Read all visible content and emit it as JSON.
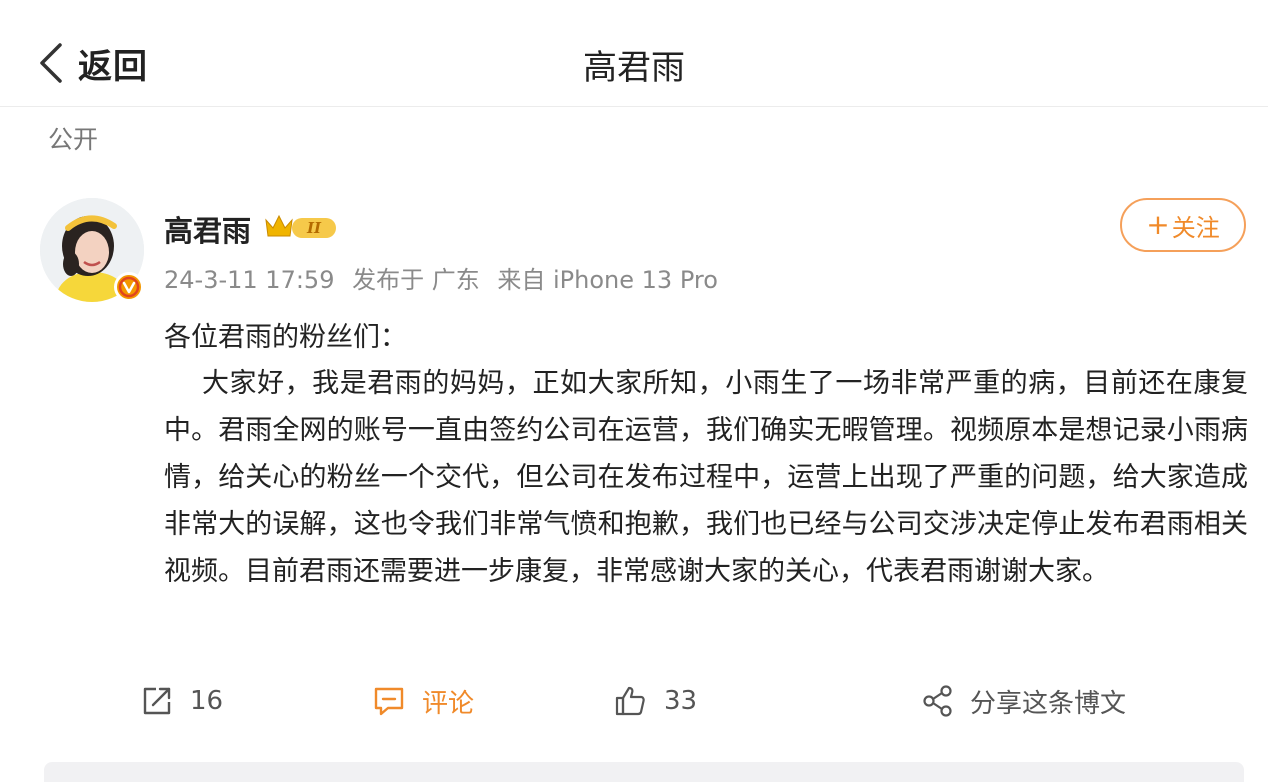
{
  "header": {
    "back_label": "返回",
    "title": "高君雨"
  },
  "post": {
    "visibility": "公开",
    "author": {
      "name": "高君雨",
      "vip_level": "II"
    },
    "meta": {
      "time": "24-3-11 17:59",
      "location": "发布于 广东",
      "source": "来自 iPhone 13 Pro"
    },
    "follow_label": "关注",
    "greeting": "各位君雨的粉丝们：",
    "body": "大家好，我是君雨的妈妈，正如大家所知，小雨生了一场非常严重的病，目前还在康复中。君雨全网的账号一直由签约公司在运营，我们确实无暇管理。视频原本是想记录小雨病情，给关心的粉丝一个交代，但公司在发布过程中，运营上出现了严重的问题，给大家造成非常大的误解，这也令我们非常气愤和抱歉，我们也已经与公司交涉决定停止发布君雨相关视频。目前君雨还需要进一步康复，非常感谢大家的关心，代表君雨谢谢大家。"
  },
  "actions": {
    "repost_count": "16",
    "comment_label": "评论",
    "like_count": "33",
    "share_label": "分享这条博文"
  },
  "colors": {
    "accent": "#f08a2a",
    "follow_border": "#f5a05a",
    "vip_gold": "#f0b400"
  }
}
